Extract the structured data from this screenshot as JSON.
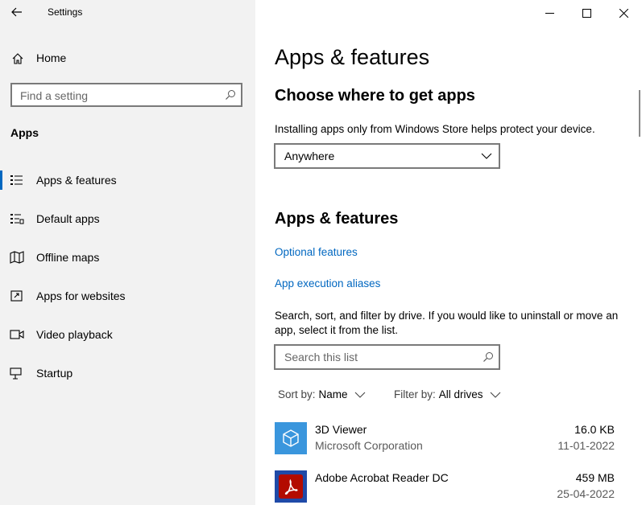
{
  "window": {
    "title": "Settings",
    "controls": {
      "minimize": "minimize",
      "maximize": "maximize",
      "close": "close"
    }
  },
  "sidebar": {
    "home_label": "Home",
    "search_placeholder": "Find a setting",
    "section_title": "Apps",
    "items": [
      {
        "label": "Apps & features",
        "icon": "apps-features-icon",
        "active": true
      },
      {
        "label": "Default apps",
        "icon": "default-apps-icon",
        "active": false
      },
      {
        "label": "Offline maps",
        "icon": "map-icon",
        "active": false
      },
      {
        "label": "Apps for websites",
        "icon": "open-external-icon",
        "active": false
      },
      {
        "label": "Video playback",
        "icon": "video-icon",
        "active": false
      },
      {
        "label": "Startup",
        "icon": "startup-icon",
        "active": false
      }
    ]
  },
  "main": {
    "page_title": "Apps & features",
    "choose_heading": "Choose where to get apps",
    "choose_desc": "Installing apps only from Windows Store helps protect your device.",
    "source_dropdown": {
      "value": "Anywhere"
    },
    "features_heading": "Apps & features",
    "links": {
      "optional_features": "Optional features",
      "execution_aliases": "App execution aliases"
    },
    "search_desc": "Search, sort, and filter by drive. If you would like to uninstall or move an app, select it from the list.",
    "list_search_placeholder": "Search this list",
    "sort": {
      "label": "Sort by:",
      "value": "Name"
    },
    "filter": {
      "label": "Filter by:",
      "value": "All drives"
    },
    "apps": [
      {
        "name": "3D Viewer",
        "publisher": "Microsoft Corporation",
        "size": "16.0 KB",
        "date": "11-01-2022",
        "tile_color": "#3a96dd",
        "icon": "cube-icon"
      },
      {
        "name": "Adobe Acrobat Reader DC",
        "publisher": "",
        "size": "459 MB",
        "date": "25-04-2022",
        "tile_color": "#b30b00",
        "icon": "acrobat-icon"
      }
    ]
  },
  "colors": {
    "accent": "#0067c0",
    "sidebar_bg": "#f2f2f2"
  }
}
